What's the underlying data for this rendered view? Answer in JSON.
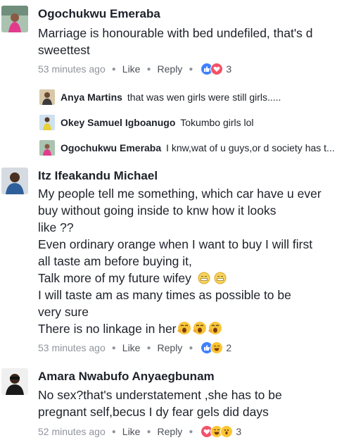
{
  "comments": [
    {
      "author": "Ogochukwu Emeraba",
      "lines": [
        "Marriage is honourable with bed undefiled, that's d",
        "sweettest"
      ],
      "time": "53 minutes ago",
      "like_label": "Like",
      "reply_label": "Reply",
      "reaction_count": "3",
      "reactions": [
        "like-reaction-icon",
        "love-reaction-icon"
      ]
    },
    {
      "author": "Itz Ifeakandu Michael",
      "lines": [
        "My people tell me something, which car have u ever",
        "buy without going inside to knw how it looks",
        "like ??",
        "Even ordinary orange when I want to buy I will first",
        "all taste am before buying it,",
        "Talk more of my future wifey",
        "I will taste am as many times as possible to be",
        "very sure",
        "There is no linkage in her"
      ],
      "time": "53 minutes ago",
      "like_label": "Like",
      "reply_label": "Reply",
      "reaction_count": "2",
      "reactions": [
        "like-reaction-icon",
        "haha-reaction-icon"
      ]
    },
    {
      "author": "Amara Nwabufo Anyaegbunam",
      "lines": [
        "No sex?that's understatement ,she has to be",
        "pregnant self,becus I dy fear gels did days"
      ],
      "time": "52 minutes ago",
      "like_label": "Like",
      "reply_label": "Reply",
      "reaction_count": "3",
      "reactions": [
        "love-reaction-icon",
        "haha-reaction-icon",
        "wow-reaction-icon"
      ]
    }
  ],
  "replies": [
    {
      "author": "Anya Martins",
      "text": "that was wen girls were still girls....."
    },
    {
      "author": "Okey Samuel Igboanugo",
      "text": "Tokumbo girls lol"
    },
    {
      "author": "Ogochukwu Emeraba",
      "text": "I knw,wat of u guys,or d society has t..."
    }
  ],
  "colors": {
    "text": "#1d2129",
    "meta": "#90949c",
    "like_blue": "#4080ff",
    "love_red": "#f25268",
    "haha_yellow": "#fcc433"
  }
}
